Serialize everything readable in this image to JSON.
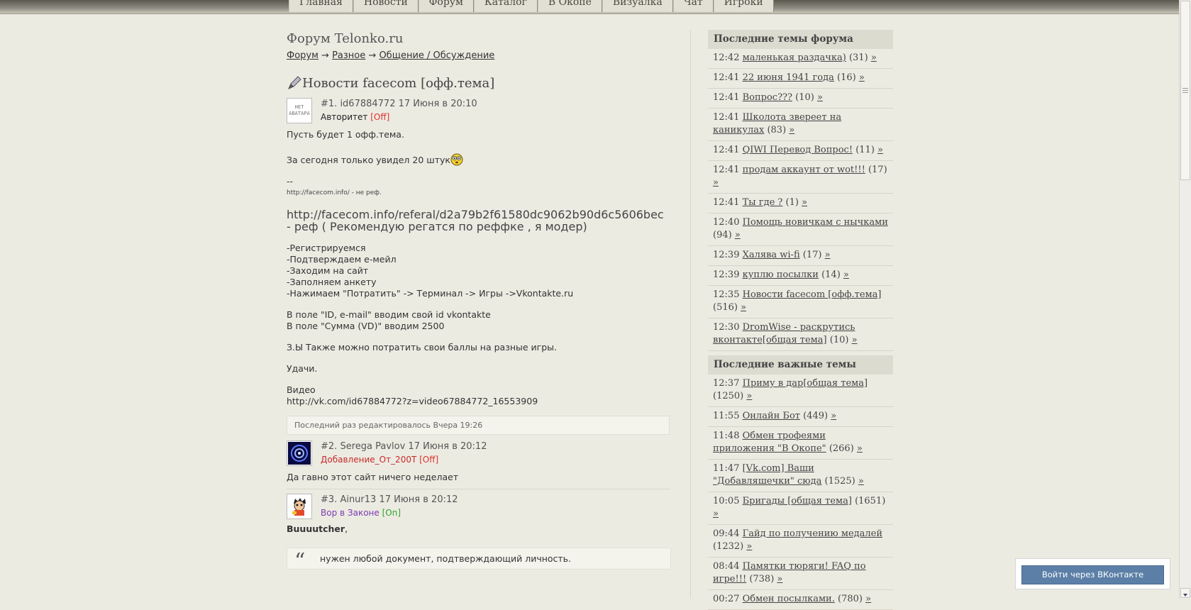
{
  "topnav": [
    "Главная",
    "Новости",
    "Форум",
    "Каталог",
    "В Окопе",
    "Визуалка",
    "Чат",
    "Игроки"
  ],
  "forum_title": "Форум Telonko.ru",
  "breadcrumb": [
    "Форум",
    "Разное",
    "Общение / Обсуждение"
  ],
  "breadcrumb_sep": "→",
  "topic_title": "Новости facecom [офф.тема]",
  "posts": [
    {
      "num": "#1.",
      "author": "id67884772",
      "date": "17 Июня в 20:10",
      "rank": "Авторитет",
      "status": "[Off]",
      "avatar_text": [
        "НЕТ",
        "АВАТАРА"
      ],
      "lines": [
        "Пусть будет 1 офф.тема.",
        "За сегодня только увидел 20 штук",
        "--"
      ],
      "small_line": "http://facecom.info/ - не реф.",
      "big_line": "http://facecom.info/referal/d2a79b2f61580dc9062b90d6c5606bec - реф ( Рекомендую регатся по реффке , я модер)",
      "steps": [
        "-Регистрируемся",
        "-Подтверждаем е-мейл",
        "-Заходим на сайт",
        "-Заполняем анкету",
        "-Нажимаем \"Потратить\" -> Терминал -> Игры ->Vkontakte.ru"
      ],
      "fields": [
        "В поле \"ID, e-mail\" вводим свой id vkontakte",
        "В поле \"Сумма (VD)\" вводим 2500"
      ],
      "ps": "З.Ы Также можно потратить свои баллы на разные игры.",
      "luck": "Удачи.",
      "video_label": "Видео",
      "video_link": "http://vk.com/id67884772?z=video67884772_16553909",
      "edited": "Последний раз редактировалось Вчера 19:26"
    },
    {
      "num": "#2.",
      "author": "Serega Pavlov",
      "date": "17 Июня в 20:12",
      "rank": "Добавление_От_200Т",
      "status": "[Off]",
      "text": "Да гавно этот сайт ничего неделает"
    },
    {
      "num": "#3.",
      "author": "Ainur13",
      "date": "17 Июня в 20:12",
      "rank": "Вор в Законе",
      "status": "[On]",
      "bold_name": "Buuuutcher",
      "comma": ",",
      "quote_mark": "“",
      "quote": "нужен любой документ, подтверждающий личность."
    }
  ],
  "sidebar": {
    "recent_title": "Последние темы форума",
    "recent": [
      {
        "time": "12:42",
        "title": "маленькая раздачка)",
        "count": "(31)",
        "more": "»"
      },
      {
        "time": "12:41",
        "title": "22 июня 1941 года",
        "count": "(16)",
        "more": "»"
      },
      {
        "time": "12:41",
        "title": "Вопрос???",
        "count": "(10)",
        "more": "»"
      },
      {
        "time": "12:41",
        "title": "Школота звереет на каникулах",
        "count": "(83)",
        "more": "»"
      },
      {
        "time": "12:41",
        "title": "QIWI Перевод Вопрос!",
        "count": "(11)",
        "more": "»"
      },
      {
        "time": "12:41",
        "title": "продам аккаунт от wot!!!",
        "count": "(17)",
        "more": "»"
      },
      {
        "time": "12:41",
        "title": "Ты где ?",
        "count": "(1)",
        "more": "»"
      },
      {
        "time": "12:40",
        "title": "Помощь новичкам с нычками",
        "count": "(94)",
        "more": "»"
      },
      {
        "time": "12:39",
        "title": "Халява wi-fi",
        "count": "(17)",
        "more": "»"
      },
      {
        "time": "12:39",
        "title": "куплю посылки",
        "count": "(14)",
        "more": "»"
      },
      {
        "time": "12:35",
        "title": "Новости facecom [офф.тема]",
        "count": "(516)",
        "more": "»"
      },
      {
        "time": "12:30",
        "title": "DromWise - раскрутись вконтакте[общая тема]",
        "count": "(10)",
        "more": "»"
      }
    ],
    "important_title": "Последние важные темы",
    "important": [
      {
        "time": "12:37",
        "title": "Приму в дар[общая тема]",
        "count": "(1250)",
        "more": "»"
      },
      {
        "time": "11:55",
        "title": "Онлайн Бот",
        "count": "(449)",
        "more": "»"
      },
      {
        "time": "11:48",
        "title": "Обмен трофеями приложения \"В Окопе\"",
        "count": "(266)",
        "more": "»"
      },
      {
        "time": "11:47",
        "title": "[Vk.com] Ваши \"Добавляшечки\" сюда",
        "count": "(1525)",
        "more": "»"
      },
      {
        "time": "10:05",
        "title": "Бригады [общая тема]",
        "count": "(1651)",
        "more": "»"
      },
      {
        "time": "09:44",
        "title": "Гайд по получению медалей",
        "count": "(1232)",
        "more": "»"
      },
      {
        "time": "08:44",
        "title": "Памятки тюряги! FAQ по игре!!!",
        "count": "(738)",
        "more": "»"
      },
      {
        "time": "00:27",
        "title": "Обмен посылками.",
        "count": "(780)",
        "more": "»"
      }
    ]
  },
  "vk_login": "Войти через ВКонтакте",
  "colors": {
    "off": "#e0302a",
    "on": "#2fa52f",
    "rank2": "#c62a2a",
    "rank3": "#7a3ab0",
    "vk": "#5b7fa6"
  }
}
